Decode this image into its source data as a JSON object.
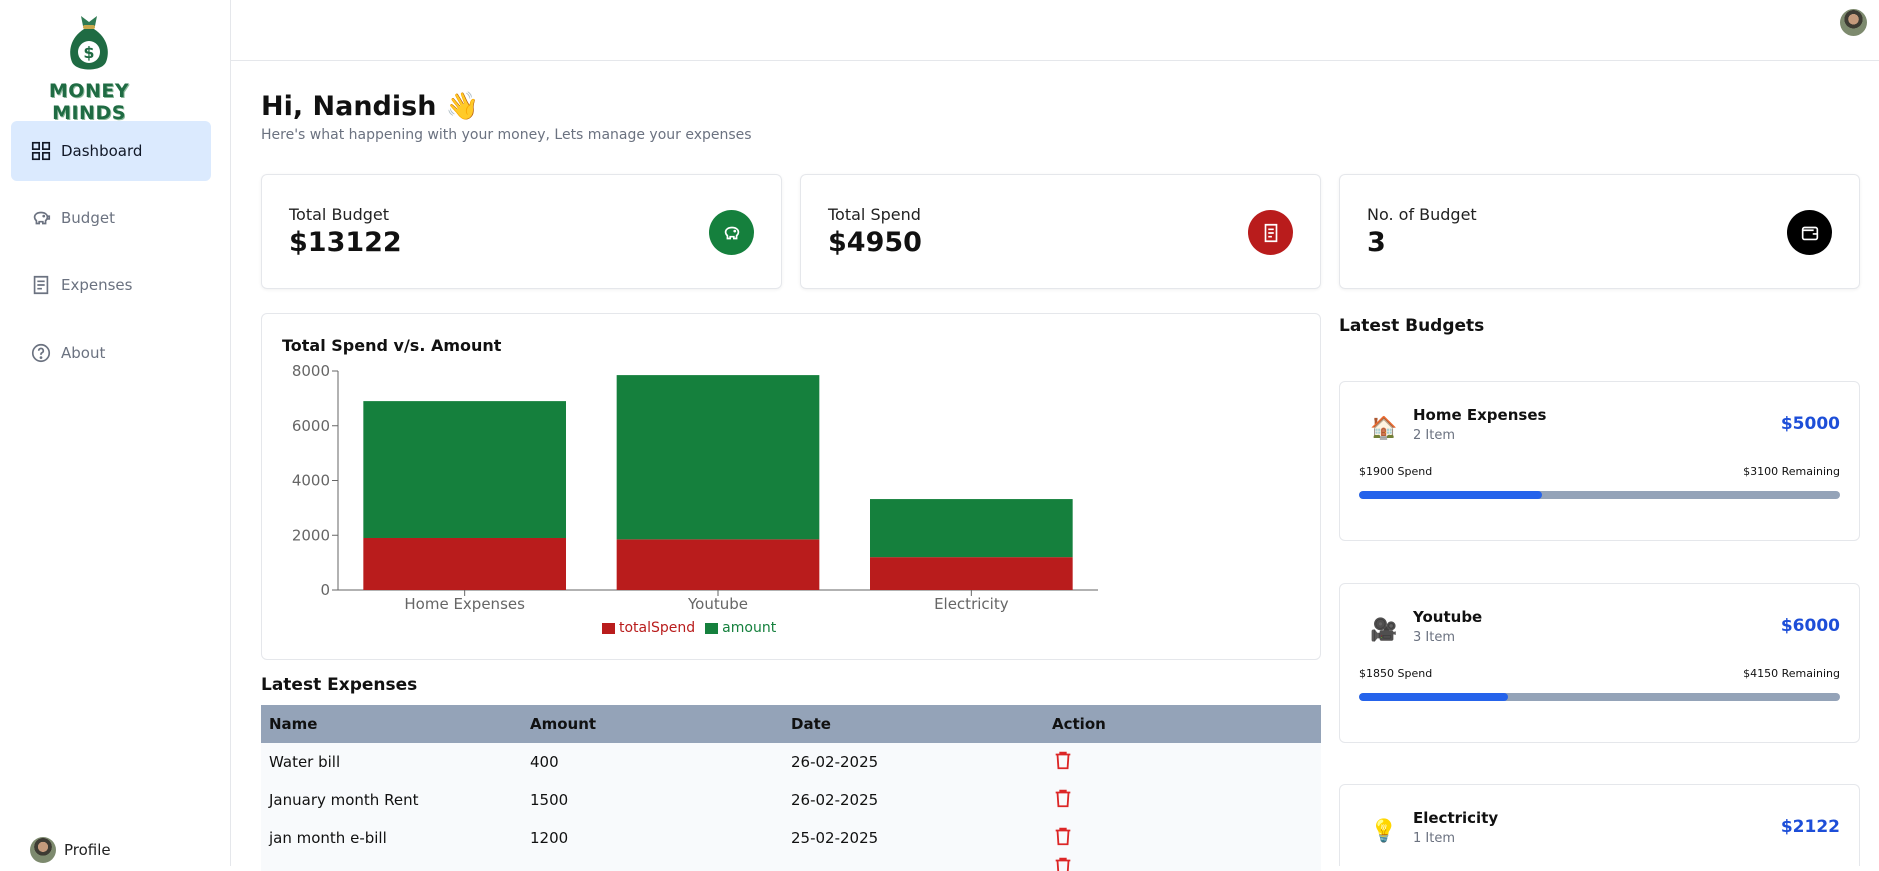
{
  "sidebar": {
    "logo_text": "MONEY MINDS",
    "items": [
      {
        "label": "Dashboard",
        "icon": "grid-icon"
      },
      {
        "label": "Budget",
        "icon": "piggy-bank-icon"
      },
      {
        "label": "Expenses",
        "icon": "receipt-icon"
      },
      {
        "label": "About",
        "icon": "help-circle-icon"
      }
    ],
    "profile_label": "Profile"
  },
  "header": {
    "greeting": "Hi, Nandish 👋",
    "subtitle": "Here's what happening with your money, Lets manage your expenses"
  },
  "stats": [
    {
      "label": "Total Budget",
      "value": "$13122",
      "icon": "piggy-bank-icon",
      "color": "#15803d"
    },
    {
      "label": "Total Spend",
      "value": "$4950",
      "icon": "receipt-icon",
      "color": "#b91c1c"
    },
    {
      "label": "No. of Budget",
      "value": "3",
      "icon": "wallet-icon",
      "color": "#000000"
    }
  ],
  "chart_data": {
    "type": "bar",
    "title": "Total Spend v/s. Amount",
    "stacked": true,
    "categories": [
      "Home Expenses",
      "Youtube",
      "Electricity"
    ],
    "series": [
      {
        "name": "totalSpend",
        "values": [
          1900,
          1850,
          1200
        ],
        "color": "#b91c1c"
      },
      {
        "name": "amount",
        "values": [
          5000,
          6000,
          2122
        ],
        "color": "#15803d"
      }
    ],
    "ylim": [
      0,
      8000
    ],
    "yticks": [
      "0",
      "2000",
      "4000",
      "6000",
      "8000"
    ],
    "legend_position": "bottom"
  },
  "latest_expenses": {
    "title": "Latest Expenses",
    "columns": [
      "Name",
      "Amount",
      "Date",
      "Action"
    ],
    "rows": [
      {
        "name": "Water bill",
        "amount": "400",
        "date": "26-02-2025"
      },
      {
        "name": "January month Rent",
        "amount": "1500",
        "date": "26-02-2025"
      },
      {
        "name": "jan month e-bill",
        "amount": "1200",
        "date": "25-02-2025"
      }
    ]
  },
  "latest_budgets": {
    "title": "Latest Budgets",
    "items": [
      {
        "emoji": "🏠",
        "name": "Home Expenses",
        "items": "2 Item",
        "amount": "$5000",
        "spend": "$1900 Spend",
        "remaining": "$3100 Remaining",
        "progress": 0.38
      },
      {
        "emoji": "🎥",
        "name": "Youtube",
        "items": "3 Item",
        "amount": "$6000",
        "spend": "$1850 Spend",
        "remaining": "$4150 Remaining",
        "progress": 0.31
      },
      {
        "emoji": "💡",
        "name": "Electricity",
        "items": "1 Item",
        "amount": "$2122"
      }
    ]
  }
}
